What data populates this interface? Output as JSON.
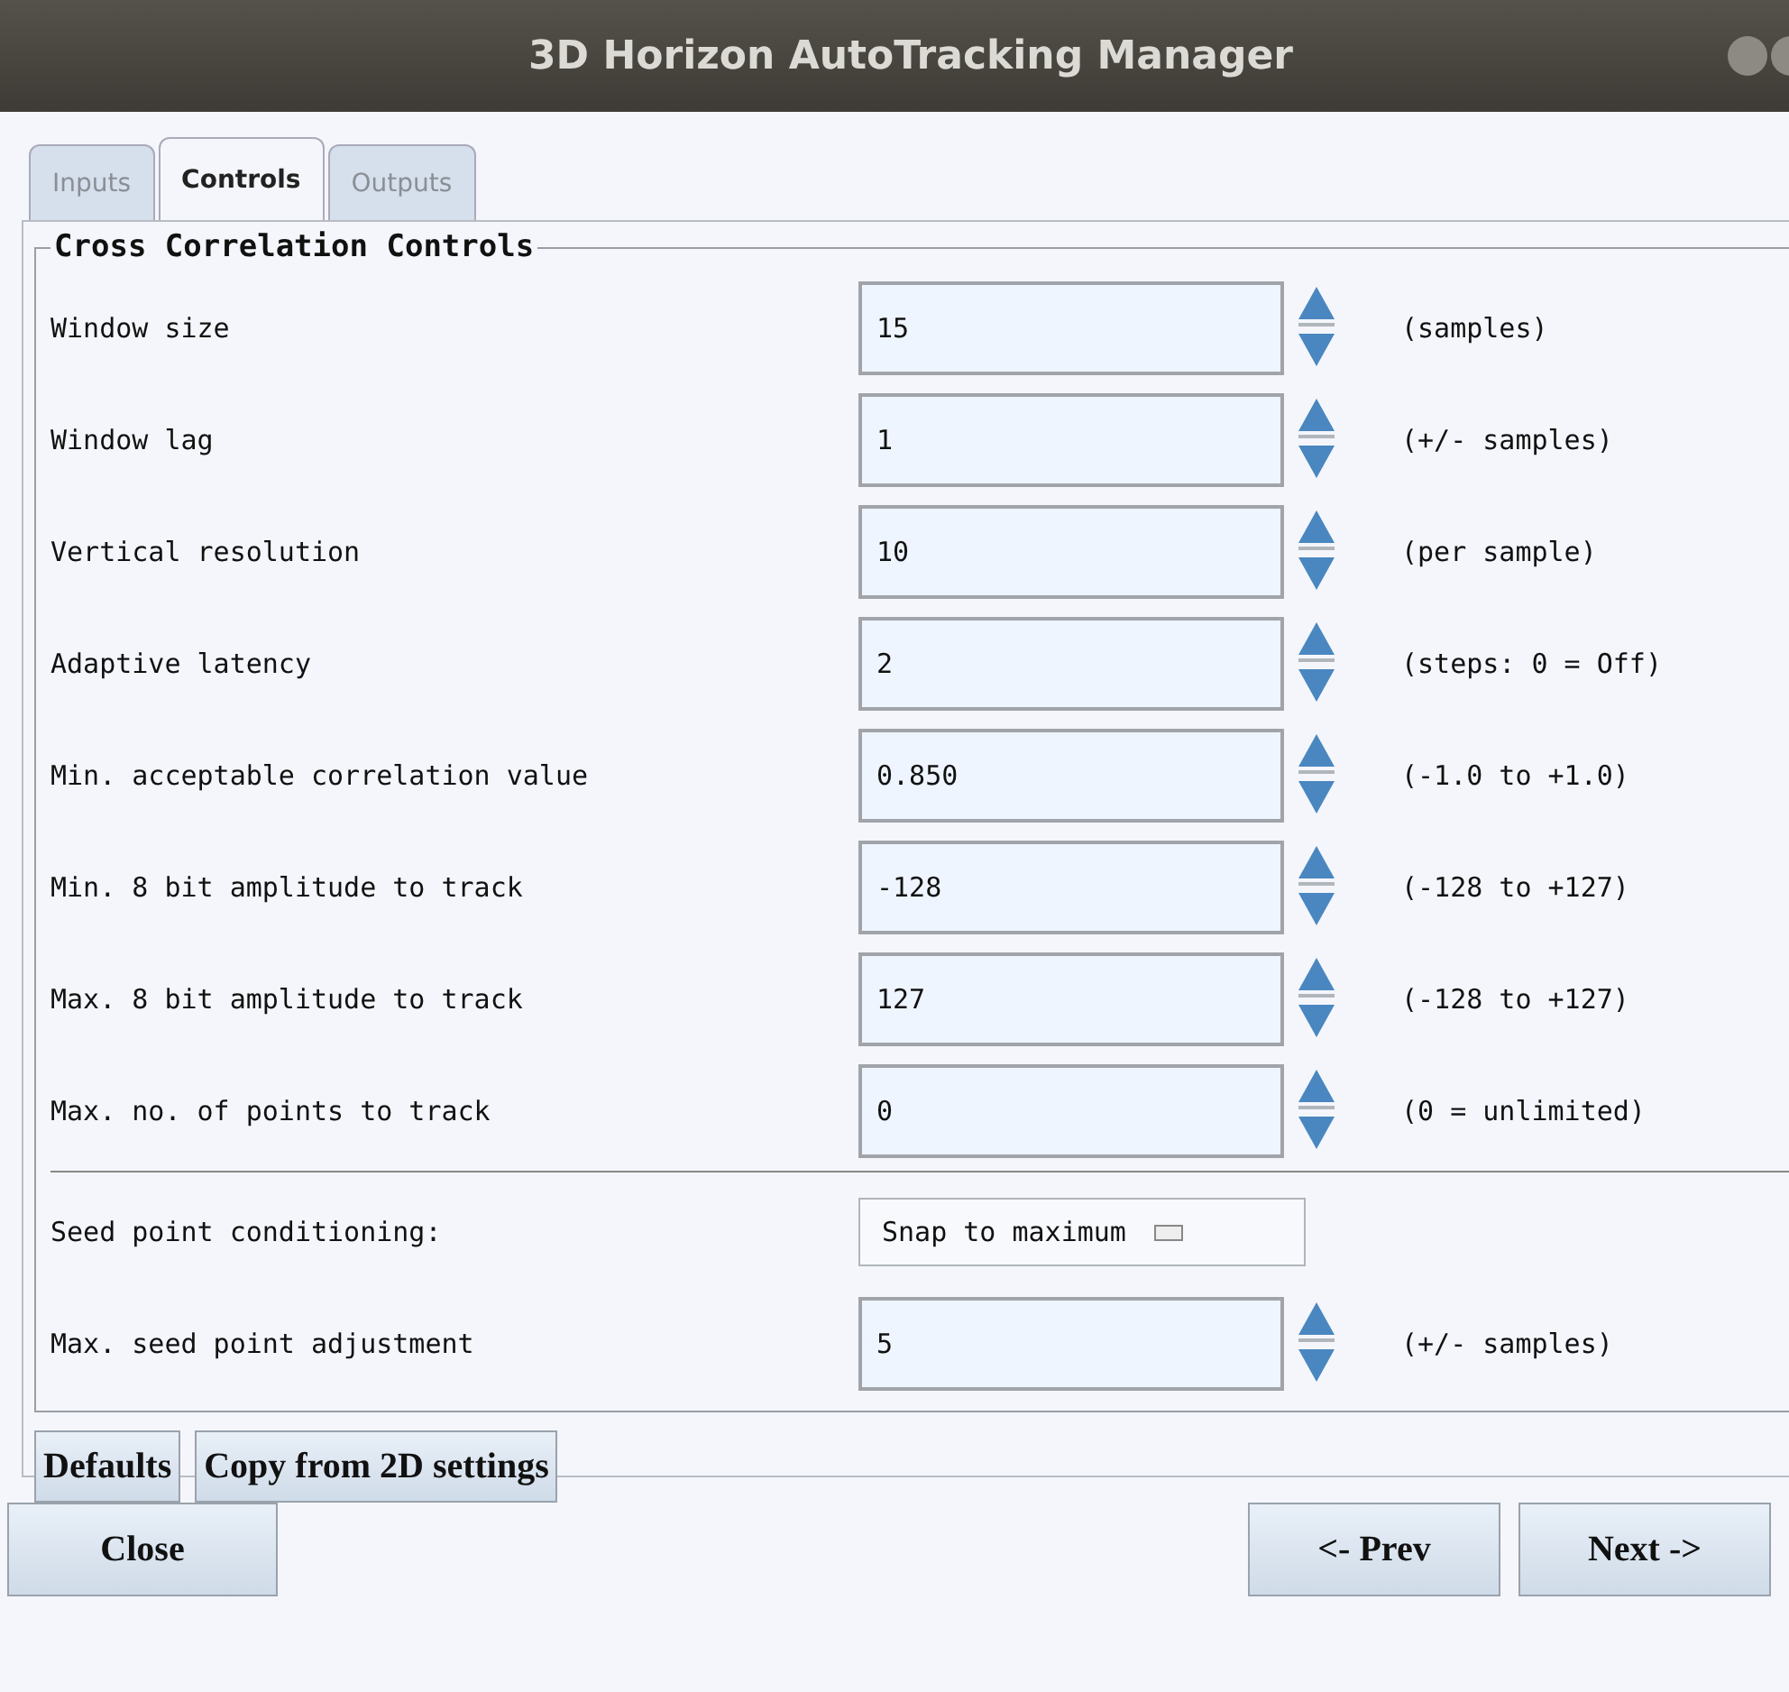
{
  "window": {
    "title": "3D Horizon AutoTracking Manager"
  },
  "tabs": [
    {
      "label": "Inputs",
      "selected": false,
      "disabled": true
    },
    {
      "label": "Controls",
      "selected": true,
      "disabled": false
    },
    {
      "label": "Outputs",
      "selected": false,
      "disabled": true
    }
  ],
  "group": {
    "title": "Cross Correlation Controls"
  },
  "rows": [
    {
      "kind": "spin",
      "label": "Window size",
      "value": "15",
      "unit": "(samples)"
    },
    {
      "kind": "spin",
      "label": "Window lag",
      "value": "1",
      "unit": "(+/- samples)"
    },
    {
      "kind": "spin",
      "label": "Vertical resolution",
      "value": "10",
      "unit": "(per sample)"
    },
    {
      "kind": "spin",
      "label": "Adaptive latency",
      "value": "2",
      "unit": "(steps: 0 = Off)"
    },
    {
      "kind": "spin",
      "label": "Min. acceptable correlation value",
      "value": "0.850",
      "unit": "(-1.0 to +1.0)"
    },
    {
      "kind": "spin",
      "label": "Min. 8 bit amplitude to track",
      "value": "-128",
      "unit": "(-128 to +127)"
    },
    {
      "kind": "spin",
      "label": "Max. 8 bit amplitude to track",
      "value": "127",
      "unit": "(-128 to +127)"
    },
    {
      "kind": "spin",
      "label": "Max. no. of points to track",
      "value": "0",
      "unit": "(0 = unlimited)"
    },
    {
      "kind": "separator"
    },
    {
      "kind": "option",
      "label": "Seed point conditioning:",
      "value": "Snap to maximum"
    },
    {
      "kind": "spin",
      "label": "Max. seed point adjustment",
      "value": "5",
      "unit": "(+/- samples)"
    }
  ],
  "group_buttons": [
    "Defaults",
    "Copy from 2D settings"
  ],
  "footer": {
    "left": [
      "Close"
    ],
    "right": [
      "<- Prev",
      "Next ->"
    ]
  }
}
